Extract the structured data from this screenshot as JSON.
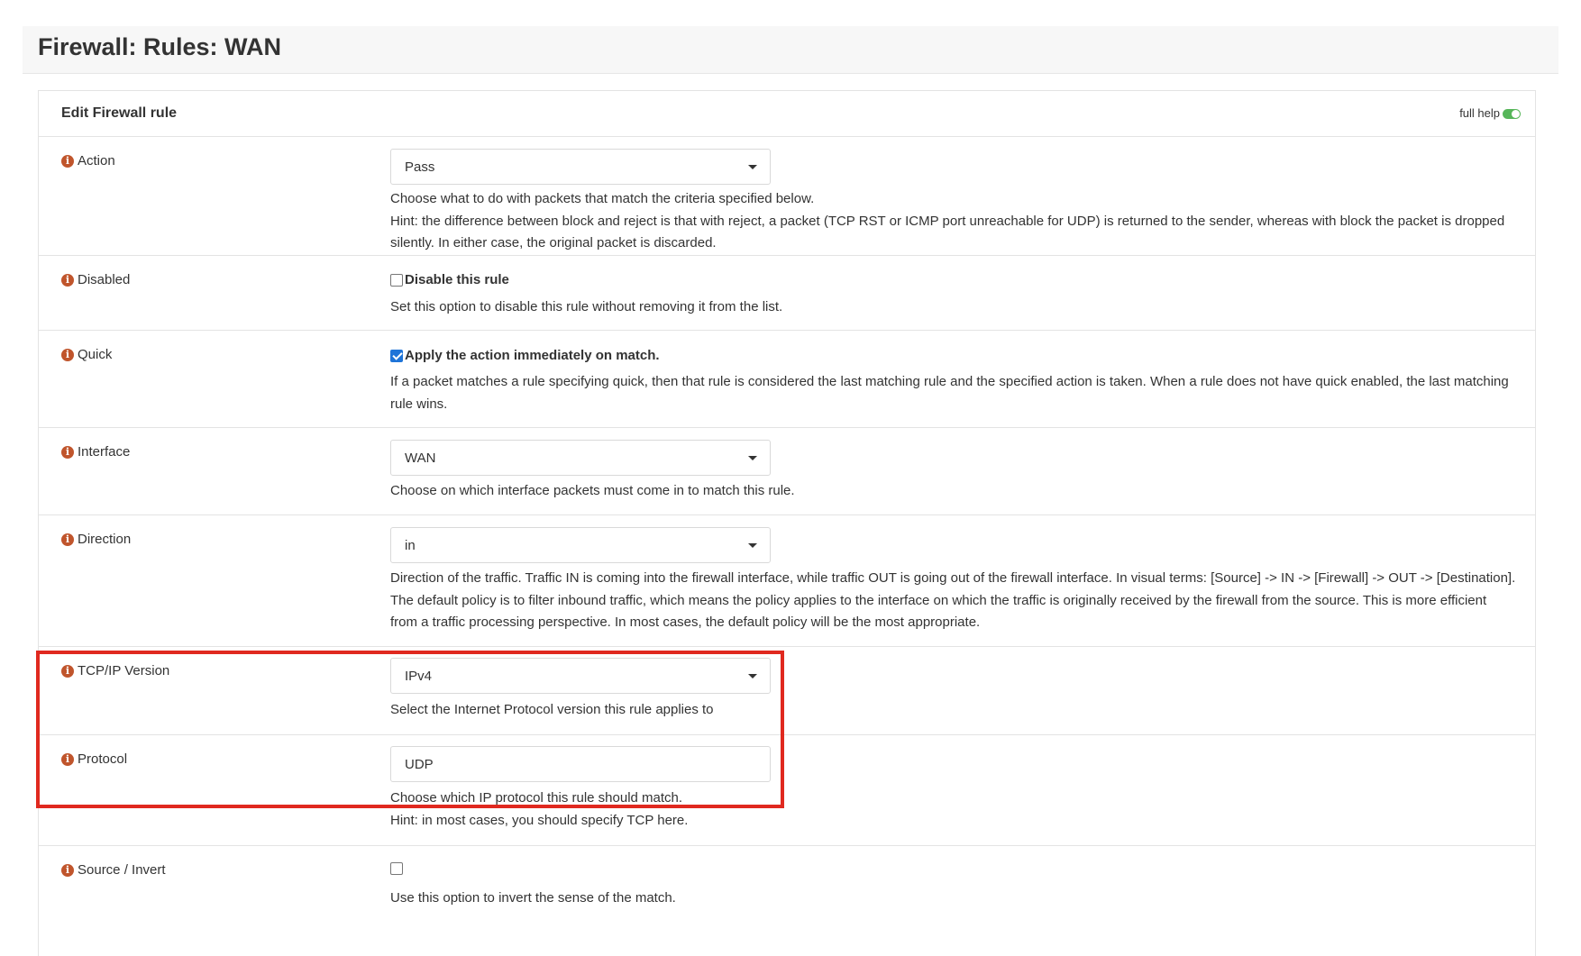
{
  "page": {
    "title": "Firewall: Rules: WAN"
  },
  "panel": {
    "title": "Edit Firewall rule",
    "full_help_label": "full help"
  },
  "fields": {
    "action": {
      "label": "Action",
      "value": "Pass",
      "help": "Choose what to do with packets that match the criteria specified below.",
      "hint": "Hint: the difference between block and reject is that with reject, a packet (TCP RST or ICMP port unreachable for UDP) is returned to the sender, whereas with block the packet is dropped silently. In either case, the original packet is discarded."
    },
    "disabled": {
      "label": "Disabled",
      "checkbox_label": "Disable this rule",
      "checked": false,
      "help": "Set this option to disable this rule without removing it from the list."
    },
    "quick": {
      "label": "Quick",
      "checkbox_label": "Apply the action immediately on match.",
      "checked": true,
      "help": "If a packet matches a rule specifying quick, then that rule is considered the last matching rule and the specified action is taken. When a rule does not have quick enabled, the last matching rule wins."
    },
    "interface": {
      "label": "Interface",
      "value": "WAN",
      "help": "Choose on which interface packets must come in to match this rule."
    },
    "direction": {
      "label": "Direction",
      "value": "in",
      "help": "Direction of the traffic. Traffic IN is coming into the firewall interface, while traffic OUT is going out of the firewall interface. In visual terms: [Source] -> IN -> [Firewall] -> OUT -> [Destination]. The default policy is to filter inbound traffic, which means the policy applies to the interface on which the traffic is originally received by the firewall from the source. This is more efficient from a traffic processing perspective. In most cases, the default policy will be the most appropriate."
    },
    "tcpip_version": {
      "label": "TCP/IP Version",
      "value": "IPv4",
      "help": "Select the Internet Protocol version this rule applies to"
    },
    "protocol": {
      "label": "Protocol",
      "value": "UDP",
      "help": "Choose which IP protocol this rule should match.",
      "hint": "Hint: in most cases, you should specify TCP here."
    },
    "source_invert": {
      "label": "Source / Invert",
      "checked": false,
      "help": "Use this option to invert the sense of the match."
    }
  },
  "colors": {
    "info_icon": "#c0552c",
    "highlight_box": "#e0291f",
    "toggle_on": "#57b65a",
    "checkbox_checked": "#1e74d8"
  }
}
